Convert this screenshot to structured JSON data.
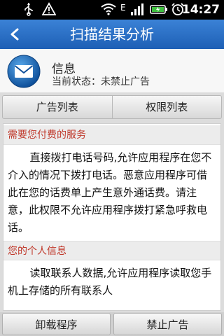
{
  "status_bar": {
    "time": "14:27",
    "icons": [
      "usb-icon",
      "warning-icon",
      "wifi-icon",
      "edge-signal-icon",
      "cell-signal-icon",
      "battery-icon",
      "alarm-icon"
    ]
  },
  "header": {
    "title": "扫描结果分析",
    "back_icon": "back-arrow-icon"
  },
  "app": {
    "name": "信息",
    "status": "当前状态：未禁止广告",
    "icon": "mail-icon"
  },
  "tabs": [
    {
      "label": "广告列表"
    },
    {
      "label": "权限列表"
    }
  ],
  "sections": [
    {
      "title": "需要您付费的服务",
      "text": "直接拨打电话号码,允许应用程序在您不介入的情况下拨打电话。恶意应用程序可借此在您的话费单上产生意外通话费。请注意，此权限不允许应用程序拨打紧急呼救电话。"
    },
    {
      "title": "您的个人信息",
      "text": "读取联系人数据,允许应用程序读取您手机上存储的所有联系人"
    }
  ],
  "bottom_bar": {
    "uninstall_label": "卸载程序",
    "block_ads_label": "禁止广告"
  },
  "colors": {
    "title_bar": "#2a6fc9",
    "section_title": "#c0392b"
  }
}
